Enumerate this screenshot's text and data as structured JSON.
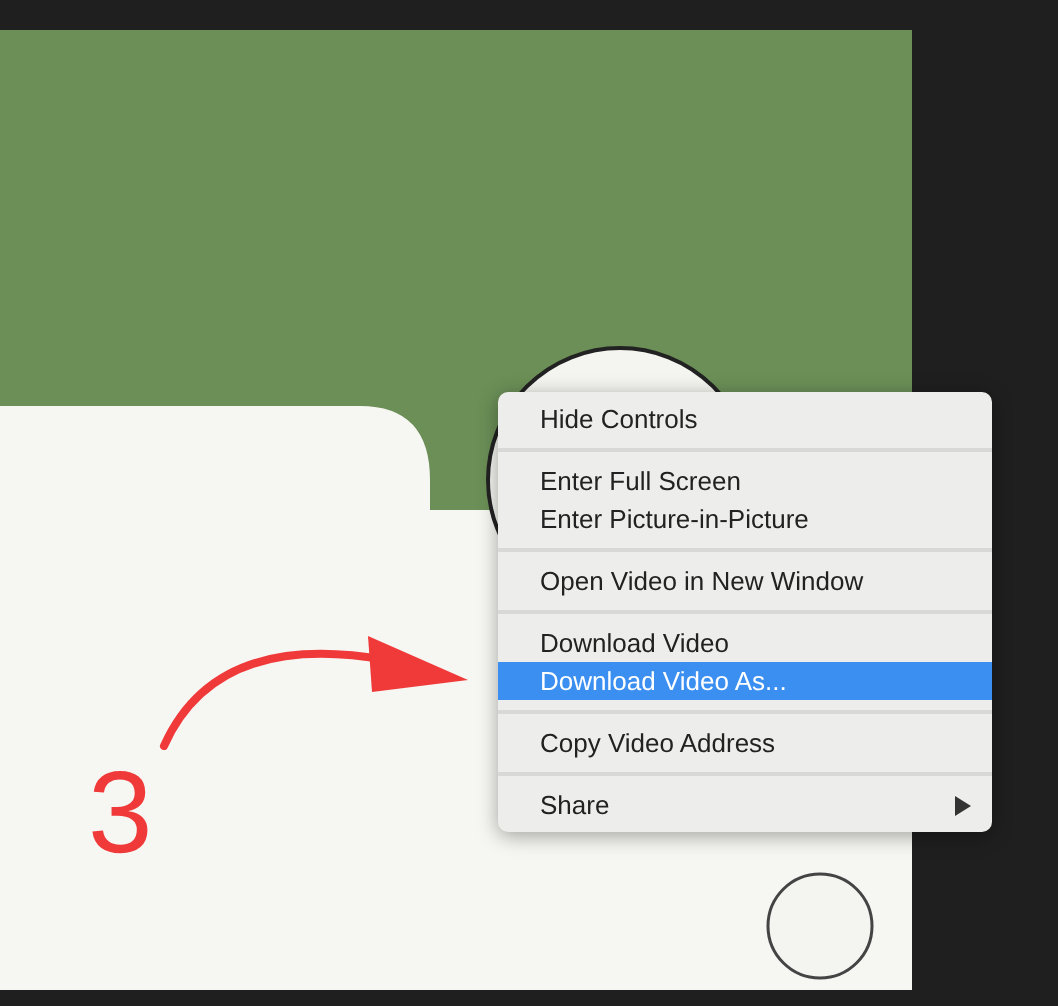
{
  "context_menu": {
    "items": [
      {
        "kind": "item",
        "label": "Hide Controls",
        "selected": false,
        "submenu": false
      },
      {
        "kind": "separator"
      },
      {
        "kind": "item",
        "label": "Enter Full Screen",
        "selected": false,
        "submenu": false
      },
      {
        "kind": "item",
        "label": "Enter Picture-in-Picture",
        "selected": false,
        "submenu": false
      },
      {
        "kind": "separator"
      },
      {
        "kind": "item",
        "label": "Open Video in New Window",
        "selected": false,
        "submenu": false
      },
      {
        "kind": "separator"
      },
      {
        "kind": "item",
        "label": "Download Video",
        "selected": false,
        "submenu": false
      },
      {
        "kind": "item",
        "label": "Download Video As...",
        "selected": true,
        "submenu": false
      },
      {
        "kind": "separator"
      },
      {
        "kind": "item",
        "label": "Copy Video Address",
        "selected": false,
        "submenu": false
      },
      {
        "kind": "separator"
      },
      {
        "kind": "item",
        "label": "Share",
        "selected": false,
        "submenu": true
      }
    ]
  },
  "annotation": {
    "label": "3"
  }
}
